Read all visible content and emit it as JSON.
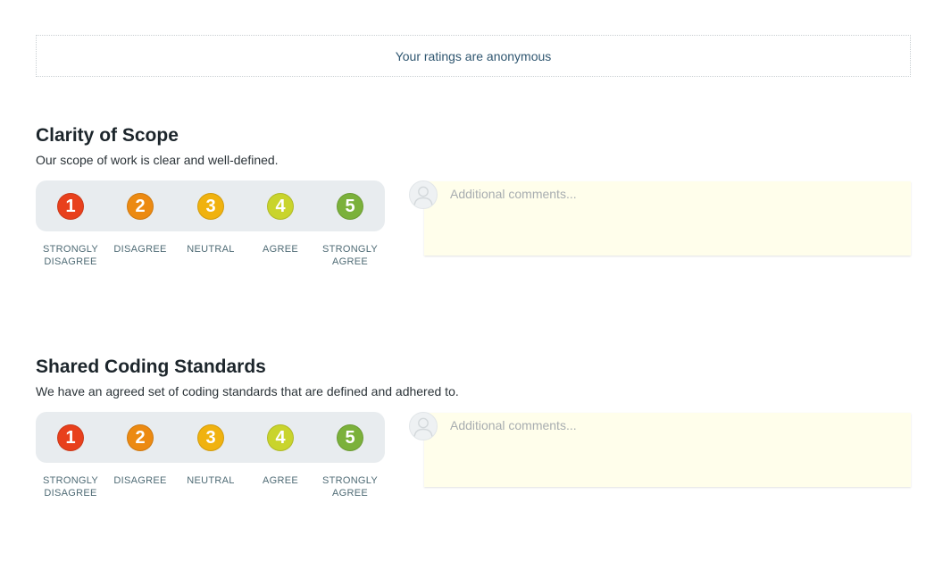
{
  "notice": {
    "text": "Your ratings are anonymous"
  },
  "scale": {
    "options": [
      {
        "value": "1",
        "label": "STRONGLY DISAGREE",
        "color": "#e8401c"
      },
      {
        "value": "2",
        "label": "DISAGREE",
        "color": "#ec8a12"
      },
      {
        "value": "3",
        "label": "NEUTRAL",
        "color": "#f0b20f"
      },
      {
        "value": "4",
        "label": "AGREE",
        "color": "#c9d42c"
      },
      {
        "value": "5",
        "label": "STRONGLY AGREE",
        "color": "#7bb13b"
      }
    ]
  },
  "questions": [
    {
      "title": "Clarity of Scope",
      "description": "Our scope of work is clear and well-defined.",
      "comment_placeholder": "Additional comments..."
    },
    {
      "title": "Shared Coding Standards",
      "description": "We have an agreed set of coding standards that are defined and adhered to.",
      "comment_placeholder": "Additional comments..."
    }
  ],
  "icons": {
    "avatar": "user-avatar-icon"
  }
}
